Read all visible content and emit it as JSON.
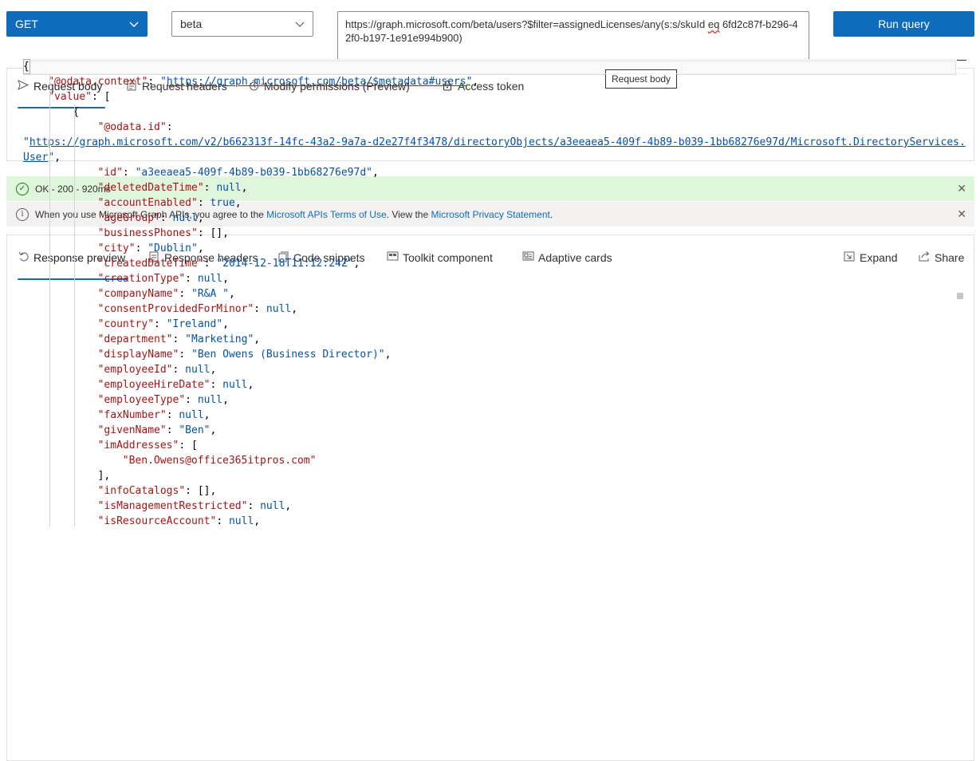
{
  "query": {
    "method": "GET",
    "version": "beta",
    "url_prefix": "https://graph.microsoft.com/beta/users?$filter=assignedLicenses/any(s:s/skuId ",
    "url_eq": "eq",
    "url_suffix": " 6fd2c87f-b296-42f0-b197-1e91e994b900)",
    "run_label": "Run query"
  },
  "request": {
    "tabs": [
      {
        "label": "Request body",
        "icon": "send-icon"
      },
      {
        "label": "Request headers",
        "icon": "document-icon"
      },
      {
        "label": "Modify permissions (Preview)",
        "icon": "permission-icon"
      },
      {
        "label": "Access token",
        "icon": "lock-icon"
      }
    ],
    "tooltip": "Request body"
  },
  "status": {
    "ok_text": "OK - 200 - 920ms",
    "info_prefix": "When you use Microsoft Graph APIs, you agree to the ",
    "info_link1": "Microsoft APIs Terms of Use",
    "info_middle": ". View the ",
    "info_link2": "Microsoft Privacy Statement",
    "info_suffix": "."
  },
  "response": {
    "tabs": [
      {
        "label": "Response preview",
        "icon": "undo-icon"
      },
      {
        "label": "Response headers",
        "icon": "document-icon"
      },
      {
        "label": "Code snippets",
        "icon": "code-icon"
      },
      {
        "label": "Toolkit component",
        "icon": "toolkit-icon"
      },
      {
        "label": "Adaptive cards",
        "icon": "card-icon"
      }
    ],
    "actions": [
      {
        "label": "Expand",
        "icon": "expand-icon"
      },
      {
        "label": "Share",
        "icon": "share-icon"
      }
    ]
  },
  "json_lines": [
    {
      "indent": 0,
      "tokens": [
        {
          "t": "p",
          "v": "{"
        }
      ]
    },
    {
      "indent": 4,
      "tokens": [
        {
          "t": "k",
          "v": "\"@odata.context\""
        },
        {
          "t": "p",
          "v": ": "
        },
        {
          "t": "s",
          "v": "\""
        },
        {
          "t": "u",
          "v": "https://graph.microsoft.com/beta/$metadata#users"
        },
        {
          "t": "s",
          "v": "\""
        },
        {
          "t": "p",
          "v": ","
        }
      ]
    },
    {
      "indent": 4,
      "tokens": [
        {
          "t": "k",
          "v": "\"value\""
        },
        {
          "t": "p",
          "v": ": ["
        }
      ]
    },
    {
      "indent": 8,
      "tokens": [
        {
          "t": "p",
          "v": "{"
        }
      ]
    },
    {
      "indent": 12,
      "tokens": [
        {
          "t": "k",
          "v": "\"@odata.id\""
        },
        {
          "t": "p",
          "v": ":"
        }
      ]
    },
    {
      "indent": 0,
      "tokens": [
        {
          "t": "s",
          "v": "\""
        },
        {
          "t": "u",
          "v": "https://graph.microsoft.com/v2/b662313f-14fc-43a2-9a7a-d2e27f4f3478/directoryObjects/a3eeaea5-409f-4b89-b039-1bb68276e97d/Microsoft.DirectoryServices."
        }
      ]
    },
    {
      "indent": 0,
      "tokens": [
        {
          "t": "u",
          "v": "User"
        },
        {
          "t": "s",
          "v": "\""
        },
        {
          "t": "p",
          "v": ","
        }
      ]
    },
    {
      "indent": 12,
      "tokens": [
        {
          "t": "k",
          "v": "\"id\""
        },
        {
          "t": "p",
          "v": ": "
        },
        {
          "t": "s",
          "v": "\"a3eeaea5-409f-4b89-b039-1bb68276e97d\""
        },
        {
          "t": "p",
          "v": ","
        }
      ]
    },
    {
      "indent": 12,
      "tokens": [
        {
          "t": "k",
          "v": "\"deletedDateTime\""
        },
        {
          "t": "p",
          "v": ": "
        },
        {
          "t": "n",
          "v": "null"
        },
        {
          "t": "p",
          "v": ","
        }
      ]
    },
    {
      "indent": 12,
      "tokens": [
        {
          "t": "k",
          "v": "\"accountEnabled\""
        },
        {
          "t": "p",
          "v": ": "
        },
        {
          "t": "n",
          "v": "true"
        },
        {
          "t": "p",
          "v": ","
        }
      ]
    },
    {
      "indent": 12,
      "tokens": [
        {
          "t": "k",
          "v": "\"ageGroup\""
        },
        {
          "t": "p",
          "v": ": "
        },
        {
          "t": "n",
          "v": "null"
        },
        {
          "t": "p",
          "v": ","
        }
      ]
    },
    {
      "indent": 12,
      "tokens": [
        {
          "t": "k",
          "v": "\"businessPhones\""
        },
        {
          "t": "p",
          "v": ": [],"
        }
      ]
    },
    {
      "indent": 12,
      "tokens": [
        {
          "t": "k",
          "v": "\"city\""
        },
        {
          "t": "p",
          "v": ": "
        },
        {
          "t": "s",
          "v": "\"Dublin\""
        },
        {
          "t": "p",
          "v": ","
        }
      ]
    },
    {
      "indent": 12,
      "tokens": [
        {
          "t": "k",
          "v": "\"createdDateTime\""
        },
        {
          "t": "p",
          "v": ": "
        },
        {
          "t": "s",
          "v": "\"2014-12-18T11:12:24Z\""
        },
        {
          "t": "p",
          "v": ","
        }
      ]
    },
    {
      "indent": 12,
      "tokens": [
        {
          "t": "k",
          "v": "\"creationType\""
        },
        {
          "t": "p",
          "v": ": "
        },
        {
          "t": "n",
          "v": "null"
        },
        {
          "t": "p",
          "v": ","
        }
      ]
    },
    {
      "indent": 12,
      "tokens": [
        {
          "t": "k",
          "v": "\"companyName\""
        },
        {
          "t": "p",
          "v": ": "
        },
        {
          "t": "s",
          "v": "\"R&A \""
        },
        {
          "t": "p",
          "v": ","
        }
      ]
    },
    {
      "indent": 12,
      "tokens": [
        {
          "t": "k",
          "v": "\"consentProvidedForMinor\""
        },
        {
          "t": "p",
          "v": ": "
        },
        {
          "t": "n",
          "v": "null"
        },
        {
          "t": "p",
          "v": ","
        }
      ]
    },
    {
      "indent": 12,
      "tokens": [
        {
          "t": "k",
          "v": "\"country\""
        },
        {
          "t": "p",
          "v": ": "
        },
        {
          "t": "s",
          "v": "\"Ireland\""
        },
        {
          "t": "p",
          "v": ","
        }
      ]
    },
    {
      "indent": 12,
      "tokens": [
        {
          "t": "k",
          "v": "\"department\""
        },
        {
          "t": "p",
          "v": ": "
        },
        {
          "t": "s",
          "v": "\"Marketing\""
        },
        {
          "t": "p",
          "v": ","
        }
      ]
    },
    {
      "indent": 12,
      "tokens": [
        {
          "t": "k",
          "v": "\"displayName\""
        },
        {
          "t": "p",
          "v": ": "
        },
        {
          "t": "s",
          "v": "\"Ben Owens (Business Director)\""
        },
        {
          "t": "p",
          "v": ","
        }
      ]
    },
    {
      "indent": 12,
      "tokens": [
        {
          "t": "k",
          "v": "\"employeeId\""
        },
        {
          "t": "p",
          "v": ": "
        },
        {
          "t": "n",
          "v": "null"
        },
        {
          "t": "p",
          "v": ","
        }
      ]
    },
    {
      "indent": 12,
      "tokens": [
        {
          "t": "k",
          "v": "\"employeeHireDate\""
        },
        {
          "t": "p",
          "v": ": "
        },
        {
          "t": "n",
          "v": "null"
        },
        {
          "t": "p",
          "v": ","
        }
      ]
    },
    {
      "indent": 12,
      "tokens": [
        {
          "t": "k",
          "v": "\"employeeType\""
        },
        {
          "t": "p",
          "v": ": "
        },
        {
          "t": "n",
          "v": "null"
        },
        {
          "t": "p",
          "v": ","
        }
      ]
    },
    {
      "indent": 12,
      "tokens": [
        {
          "t": "k",
          "v": "\"faxNumber\""
        },
        {
          "t": "p",
          "v": ": "
        },
        {
          "t": "n",
          "v": "null"
        },
        {
          "t": "p",
          "v": ","
        }
      ]
    },
    {
      "indent": 12,
      "tokens": [
        {
          "t": "k",
          "v": "\"givenName\""
        },
        {
          "t": "p",
          "v": ": "
        },
        {
          "t": "s",
          "v": "\"Ben\""
        },
        {
          "t": "p",
          "v": ","
        }
      ]
    },
    {
      "indent": 12,
      "tokens": [
        {
          "t": "k",
          "v": "\"imAddresses\""
        },
        {
          "t": "p",
          "v": ": ["
        }
      ]
    },
    {
      "indent": 16,
      "tokens": [
        {
          "t": "k",
          "v": "\"Ben.Owens@office365itpros.com\""
        }
      ]
    },
    {
      "indent": 12,
      "tokens": [
        {
          "t": "p",
          "v": "],"
        }
      ]
    },
    {
      "indent": 12,
      "tokens": [
        {
          "t": "k",
          "v": "\"infoCatalogs\""
        },
        {
          "t": "p",
          "v": ": [],"
        }
      ]
    },
    {
      "indent": 12,
      "tokens": [
        {
          "t": "k",
          "v": "\"isManagementRestricted\""
        },
        {
          "t": "p",
          "v": ": "
        },
        {
          "t": "n",
          "v": "null"
        },
        {
          "t": "p",
          "v": ","
        }
      ]
    },
    {
      "indent": 12,
      "tokens": [
        {
          "t": "k",
          "v": "\"isResourceAccount\""
        },
        {
          "t": "p",
          "v": ": "
        },
        {
          "t": "n",
          "v": "null"
        },
        {
          "t": "p",
          "v": ","
        }
      ]
    }
  ]
}
